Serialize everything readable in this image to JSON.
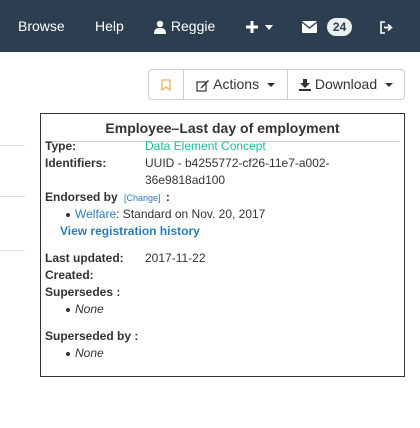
{
  "nav": {
    "browse": "Browse",
    "help": "Help",
    "user": "Reggie",
    "mail_count": "24"
  },
  "toolbar": {
    "actions": "Actions",
    "download": "Download"
  },
  "item": {
    "title": "Employee–Last day of employment",
    "type_label": "Type:",
    "type_value": "Data Element Concept",
    "identifiers_label": "Identifiers:",
    "identifier_line1": "UUID - b4255772-cf26-11e7-a002-",
    "identifier_line2": "36e9818ad100",
    "endorsed_label": "Endorsed by",
    "change_link": "[Change]",
    "colon": ":",
    "endorser_name": "Welfare",
    "endorser_status": ": Standard on Nov. 20, 2017",
    "history_link": "View registration history",
    "last_updated_label": "Last updated:",
    "last_updated_value": "2017-11-22",
    "created_label": "Created:",
    "supersedes_label": "Supersedes :",
    "supersedes_value": "None",
    "superseded_by_label": "Superseded by :",
    "superseded_by_value": "None"
  },
  "icons": {
    "user": "user-icon",
    "plus": "plus-icon",
    "envelope": "envelope-icon",
    "signout": "sign-out-icon",
    "bookmark": "bookmark-icon",
    "edit": "edit-icon",
    "download": "download-icon"
  },
  "colors": {
    "navbar": "#2c3e50",
    "link": "#18bc9c"
  }
}
